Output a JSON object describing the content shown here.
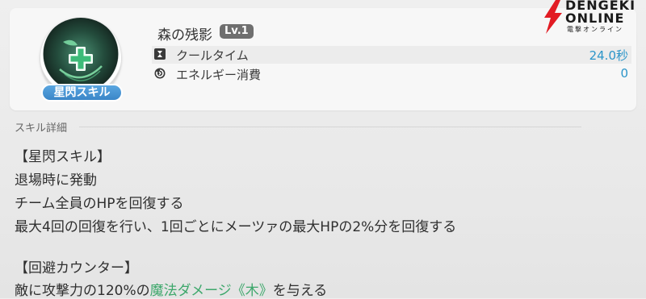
{
  "skill": {
    "name": "森の残影",
    "level": "Lv.1",
    "badge": "星閃スキル",
    "icon": "green-cross-leaf-icon",
    "stats": [
      {
        "label": "クールタイム",
        "value": "24.0秒",
        "icon": "hourglass-icon"
      },
      {
        "label": "エネルギー消費",
        "value": "0",
        "icon": "energy-icon"
      }
    ]
  },
  "details": {
    "section_label": "スキル詳細",
    "lines": [
      "【星閃スキル】",
      "退場時に発動",
      "チーム全員のHPを回復する",
      "最大4回の回復を行い、1回ごとにメーツァの最大HPの2%分を回復する",
      "【回避カウンター】"
    ],
    "last_line": {
      "before": "敵に攻撃力の120%の",
      "highlight": "魔法ダメージ《木》",
      "after": "を与える"
    }
  },
  "logo": {
    "line1": "DENGEKI",
    "line2": "ONLINE",
    "line3": "電撃オンライン"
  },
  "colors": {
    "accent_blue": "#2b95c9",
    "highlight_green": "#3da76b",
    "logo_red": "#e21c24"
  }
}
